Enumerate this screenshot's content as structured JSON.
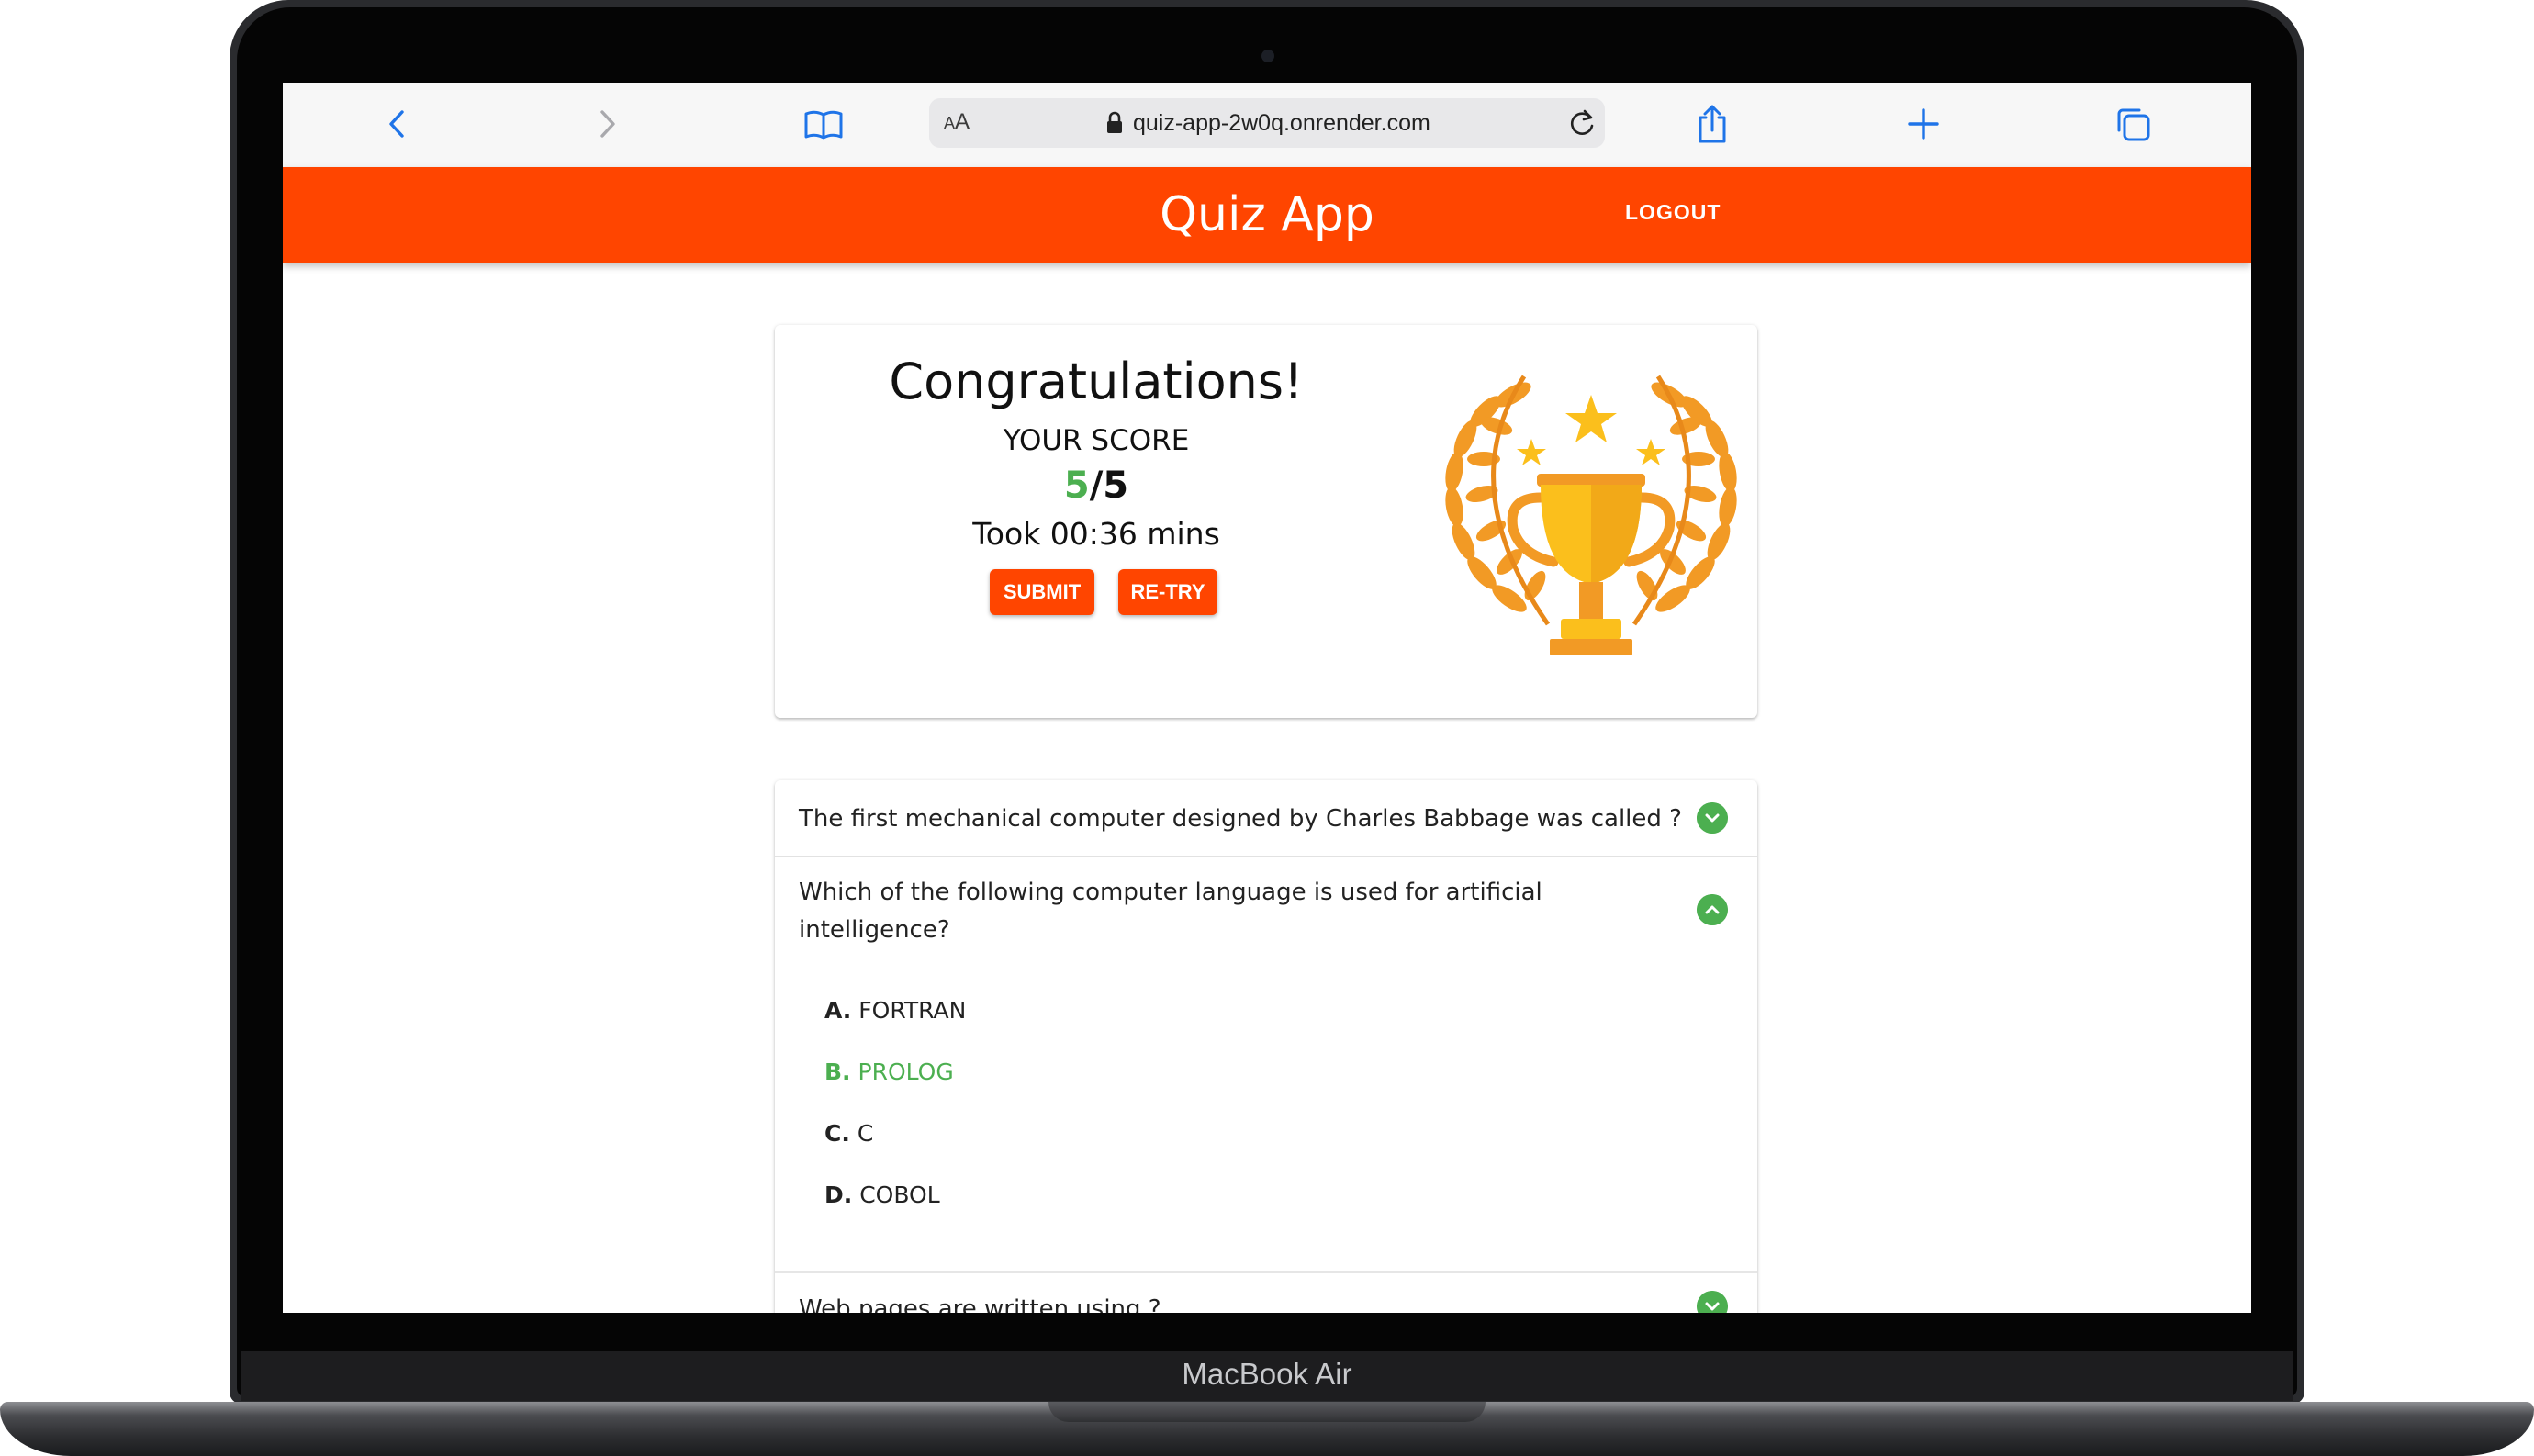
{
  "device": {
    "label": "MacBook Air"
  },
  "browser": {
    "text_size_label": "AA",
    "url": "quiz-app-2w0q.onrender.com",
    "icons": [
      "back-icon",
      "forward-icon",
      "bookmarks-icon",
      "lock-icon",
      "reload-icon",
      "share-icon",
      "new-tab-icon",
      "tabs-icon"
    ]
  },
  "app": {
    "title": "Quiz App",
    "logout_label": "LOGOUT",
    "accent_color": "#ff4500",
    "success_color": "#4caf50"
  },
  "result": {
    "heading": "Congratulations!",
    "score_label": "YOUR SCORE",
    "score_correct": "5",
    "score_total": "/5",
    "time_text": "Took 00:36 mins",
    "submit_label": "SUBMIT",
    "retry_label": "RE-TRY",
    "image": "trophy-icon"
  },
  "questions": [
    {
      "text": "The first mechanical computer designed by Charles Babbage was called ?",
      "expanded": false
    },
    {
      "text_line1": "Which of the following computer language is used for artificial",
      "text_line2": "intelligence?",
      "expanded": true,
      "options": [
        {
          "letter": "A.",
          "text": "FORTRAN",
          "correct": false
        },
        {
          "letter": "B.",
          "text": "PROLOG",
          "correct": true
        },
        {
          "letter": "C.",
          "text": "C",
          "correct": false
        },
        {
          "letter": "D.",
          "text": "COBOL",
          "correct": false
        }
      ]
    },
    {
      "text": "Web pages are written using ?",
      "expanded": false
    }
  ]
}
